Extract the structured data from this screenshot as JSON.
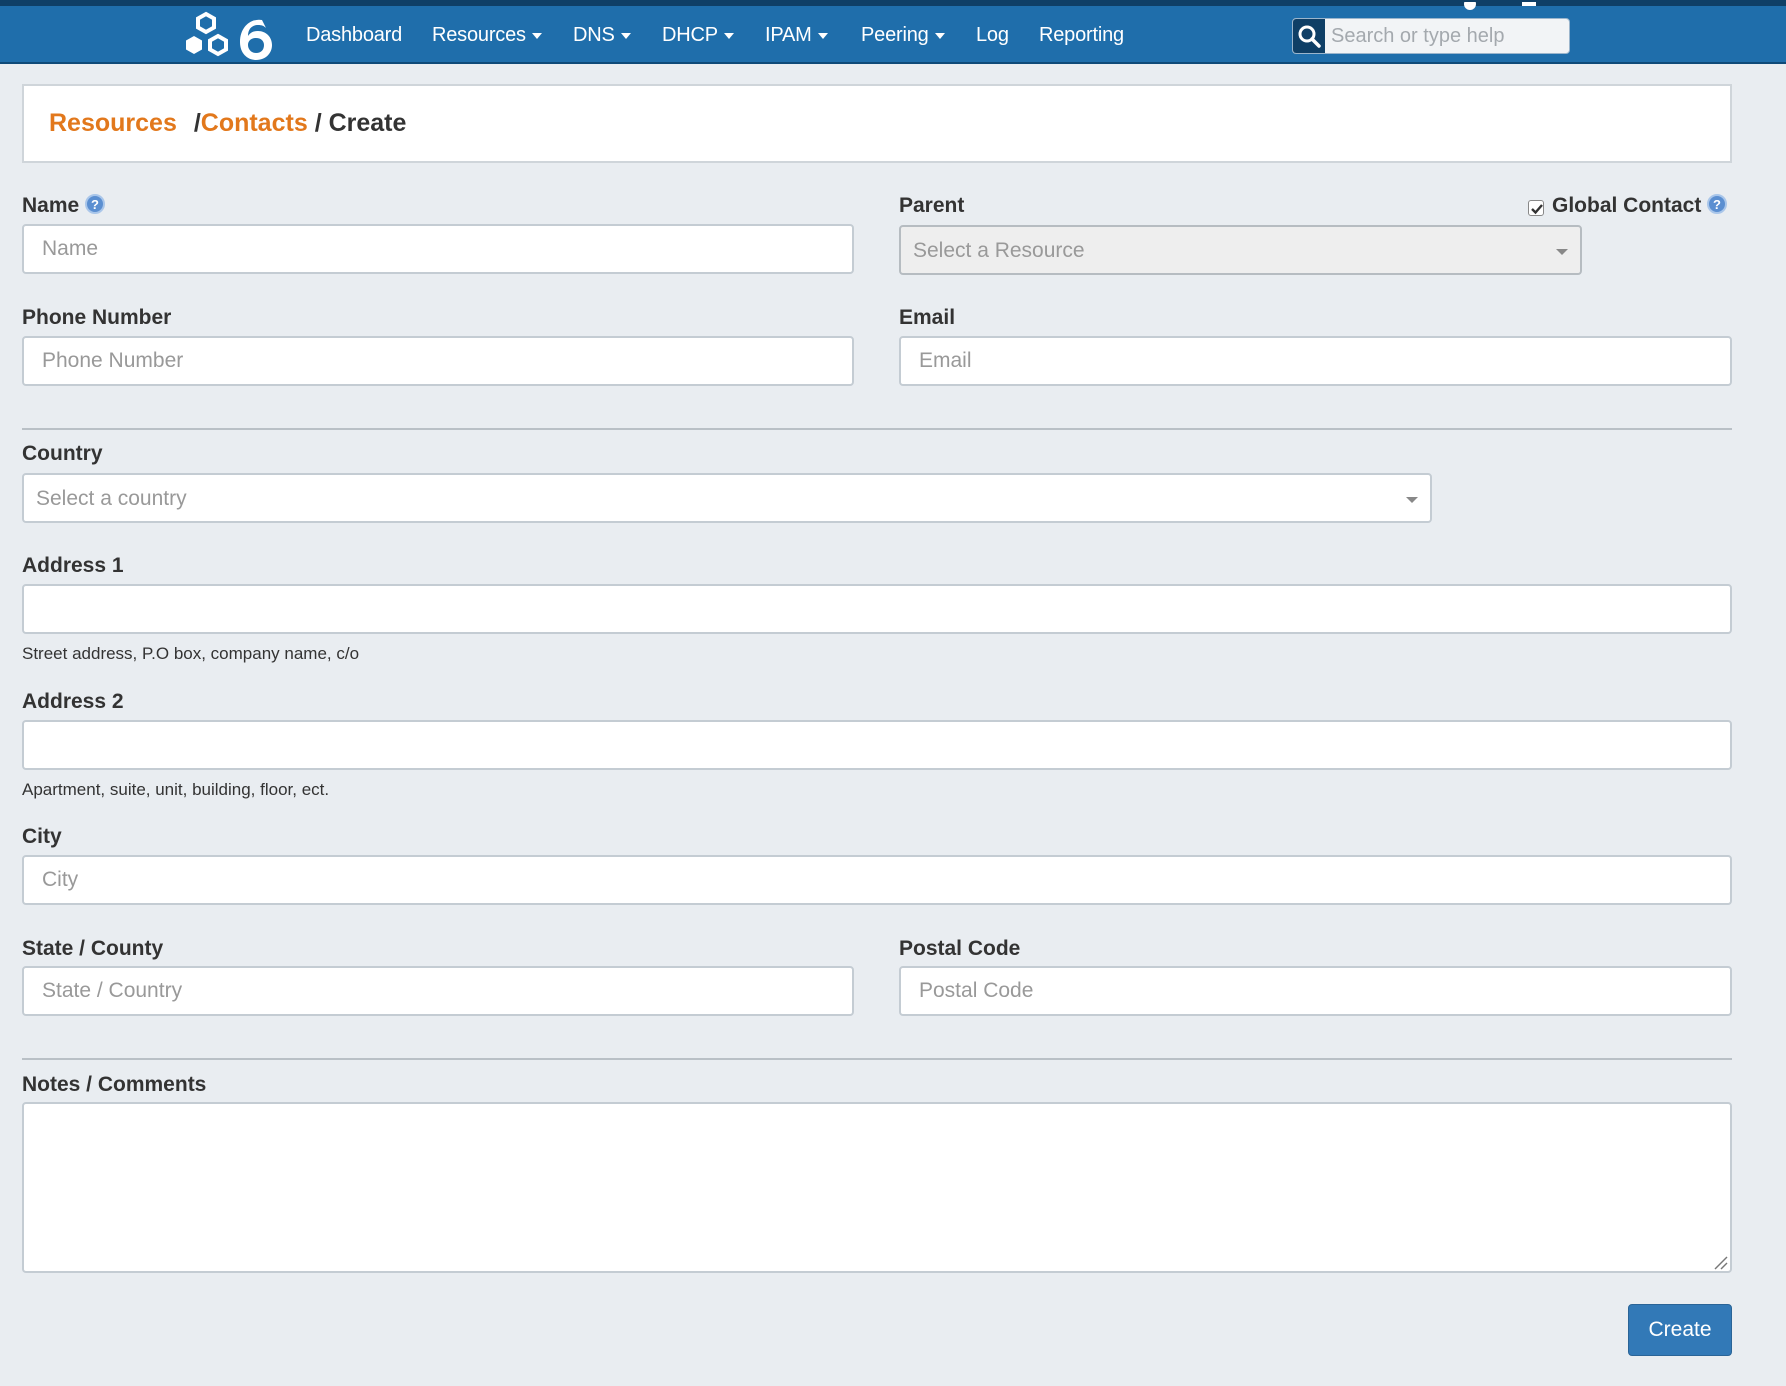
{
  "nav": {
    "items": [
      {
        "label": "Dashboard",
        "dropdown": false
      },
      {
        "label": "Resources",
        "dropdown": true
      },
      {
        "label": "DNS",
        "dropdown": true
      },
      {
        "label": "DHCP",
        "dropdown": true
      },
      {
        "label": "IPAM",
        "dropdown": true
      },
      {
        "label": "Peering",
        "dropdown": true
      },
      {
        "label": "Log",
        "dropdown": false
      },
      {
        "label": "Reporting",
        "dropdown": false
      }
    ],
    "search_placeholder": "Search or type help",
    "logo_icon": "hexagon-6-logo-icon",
    "bar_color": "#1f6eab"
  },
  "breadcrumb": {
    "items": [
      "Resources",
      "Contacts"
    ],
    "separator": "/",
    "current": "Create",
    "link_color": "#e2781c"
  },
  "form": {
    "name": {
      "label": "Name",
      "placeholder": "Name"
    },
    "parent": {
      "label": "Parent",
      "placeholder": "Select a Resource",
      "disabled": true
    },
    "global_contact": {
      "label": "Global Contact",
      "checked": true
    },
    "phone": {
      "label": "Phone Number",
      "placeholder": "Phone Number"
    },
    "email": {
      "label": "Email",
      "placeholder": "Email"
    },
    "country": {
      "label": "Country",
      "placeholder": "Select a country"
    },
    "address1": {
      "label": "Address 1",
      "hint": "Street address, P.O box, company name, c/o"
    },
    "address2": {
      "label": "Address 2",
      "hint": "Apartment, suite, unit, building, floor, ect."
    },
    "city": {
      "label": "City",
      "placeholder": "City"
    },
    "state": {
      "label": "State / County",
      "placeholder": "State / Country"
    },
    "postal": {
      "label": "Postal Code",
      "placeholder": "Postal Code"
    },
    "notes": {
      "label": "Notes / Comments"
    },
    "submit_label": "Create",
    "submit_color": "#3279b7"
  }
}
